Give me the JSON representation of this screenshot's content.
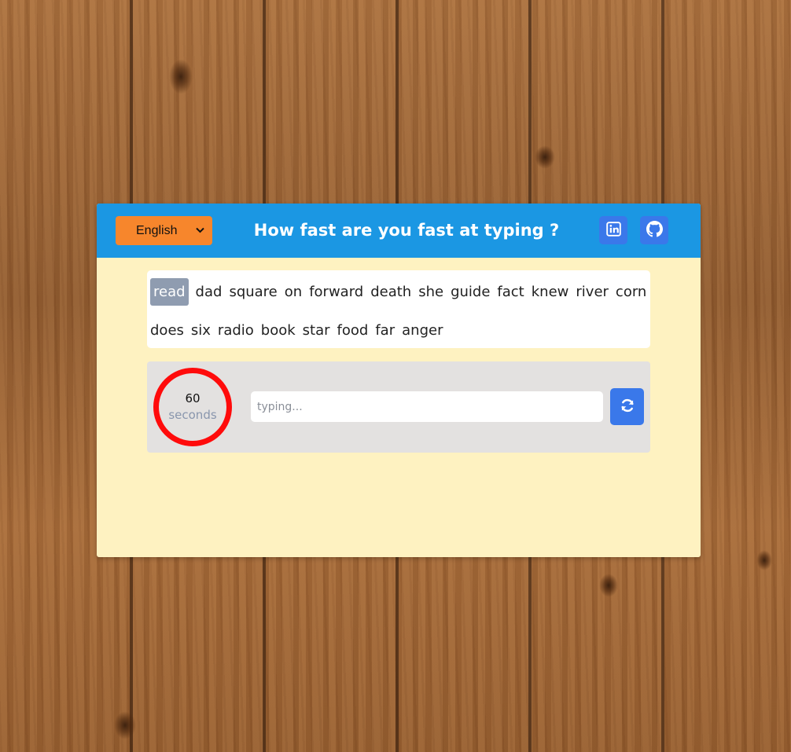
{
  "header": {
    "language_selected": "English",
    "title": "How fast are you fast at typing ?",
    "social": [
      {
        "icon": "linkedin-icon"
      },
      {
        "icon": "github-icon"
      }
    ]
  },
  "words": {
    "current": "read",
    "list": [
      "read",
      "dad",
      "square",
      "on",
      "forward",
      "death",
      "she",
      "guide",
      "fact",
      "knew",
      "river",
      "corn",
      "does",
      "six",
      "radio",
      "book",
      "star",
      "food",
      "far",
      "anger"
    ]
  },
  "timer": {
    "value": "60",
    "unit": "seconds"
  },
  "input": {
    "value": "",
    "placeholder": "typing..."
  },
  "reset": {
    "icon": "refresh-icon"
  },
  "colors": {
    "header_bg": "#1b97e3",
    "panel_bg": "#fef2c1",
    "select_bg": "#f7862c",
    "icon_button_bg": "#3a78ea",
    "current_word_bg": "#8f9cb0",
    "timer_ring": "#ff0b0b"
  }
}
